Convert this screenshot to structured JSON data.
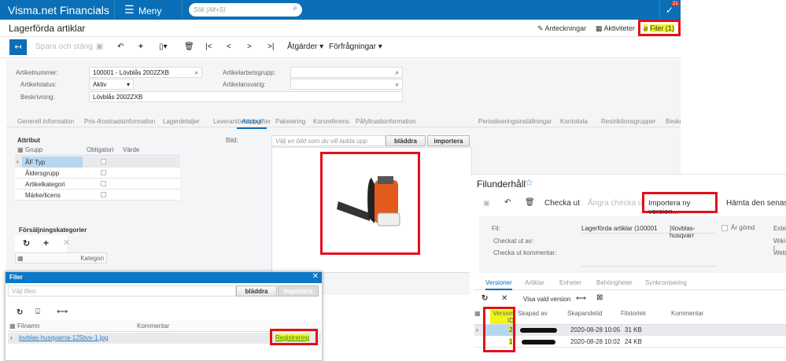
{
  "app": {
    "brand": "Visma.net Financials",
    "menu": "Meny",
    "search_placeholder": "Sök (Alt+S)",
    "notification_count": "21"
  },
  "header": {
    "title": "Lagerförda artiklar",
    "notes": "Anteckningar",
    "activities": "Aktiviteter",
    "files": "Filer (1)"
  },
  "toolbar": {
    "save_close": "Spara och stäng",
    "actions": "Åtgärder",
    "inquiries": "Förfrågningar"
  },
  "form": {
    "item_number_label": "Artikelnummer:",
    "item_number": "100001 - Lövblås 2002ZXB",
    "status_label": "Artikelstatus:",
    "status": "Aktiv",
    "description_label": "Beskrivning:",
    "description": "Lövblås 2002ZXB",
    "workgroup_label": "Artikelarbetsgrupp:",
    "responsible_label": "Artikelansvarig:"
  },
  "tabs": [
    "Generell information",
    "Pris-/kostnadsinformation",
    "Lagerdetaljer",
    "Leverantörsuppgifter",
    "Attribut",
    "Paketering",
    "Korsreferens",
    "Påfyllnadsinformation",
    "Periodiseringsinställningar",
    "Kontolista",
    "Restriktionsgrupper",
    "Beskri"
  ],
  "attributes": {
    "title": "Attribut",
    "columns": [
      "Grupp",
      "Obligatori",
      "Värde"
    ],
    "rows": [
      "ÅF Typ",
      "Åldersgrupp",
      "Artikelkategori",
      "Märke/licens"
    ]
  },
  "image": {
    "label": "Bild:",
    "placeholder": "Välj en bild som du vill ladda upp.",
    "browse": "bläddra",
    "import": "importera"
  },
  "sales_categories": {
    "title": "Försäljningskategorier",
    "column": "Kategori"
  },
  "files_dialog": {
    "title": "Filer",
    "placeholder": "Välj filen.",
    "browse": "bläddra",
    "import": "Importera",
    "columns": [
      "Filnamn",
      "Kommentar"
    ],
    "file": "lovblas-husqvarna-125bvx-1.jpg",
    "link": "Registrering"
  },
  "file_maint": {
    "title": "Filunderhåll",
    "checkout": "Checka ut",
    "undo_checkout": "Ångra checka ut",
    "import_version": "Importera ny version...",
    "get_latest": "Hämta den senaste",
    "file_label": "Fil:",
    "file_value": "Lagerförda artiklar (100001",
    "file_value2": ")\\lovblas-husqvarr",
    "hidden": "Är gömd",
    "checked_out_by": "Checkat ut av:",
    "checkout_comment": "Checka ut kommentar:",
    "ext1": "Exter",
    "ext2": "Wiki-l",
    "ext3": "WebD",
    "tabs": [
      "Versioner",
      "Artiklar",
      "Enheter",
      "Behörigheter",
      "Synkronisering"
    ],
    "show_version": "Visa vald version",
    "columns": [
      "Version ID",
      "Skapad av",
      "Skapandetid",
      "Filstorlek",
      "Kommentar"
    ],
    "rows": [
      {
        "id": "2",
        "created": "2020-08-28 10:05",
        "size": "31 KB"
      },
      {
        "id": "1",
        "created": "2020-08-28 10:02",
        "size": "24 KB"
      }
    ]
  }
}
